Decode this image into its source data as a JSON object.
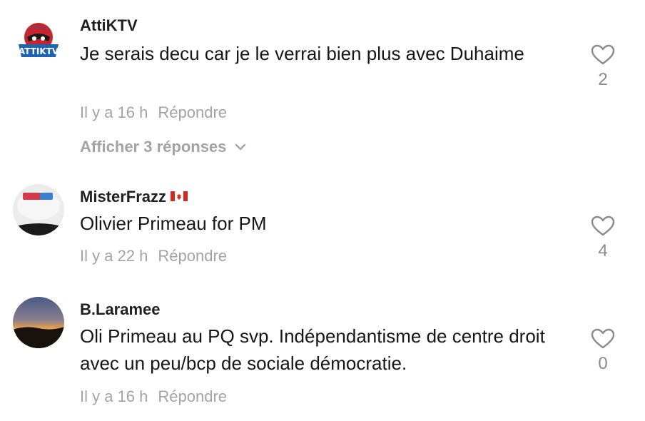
{
  "comments": [
    {
      "username": "AttiKTV",
      "avatar_text": "ATTIKTV",
      "text": "Je serais decu car je le verrai bien plus avec Duhaime",
      "time": "Il y a 16 h",
      "reply_label": "Répondre",
      "view_replies": "Afficher 3 réponses",
      "likes": "2"
    },
    {
      "username": "MisterFrazz",
      "flag_icon": "canada-flag-icon",
      "text": "Olivier Primeau for PM",
      "time": "Il y a 22 h",
      "reply_label": "Répondre",
      "likes": "4"
    },
    {
      "username": "B.Laramee",
      "text": "Oli Primeau au PQ svp. Indépendantisme de centre droit avec un peu/bcp de sociale démocratie.",
      "time": "Il y a 16 h",
      "reply_label": "Répondre",
      "likes": "0"
    }
  ],
  "colors": {
    "primary_text": "#161616",
    "secondary_text": "#a3a3a7",
    "heart_outline": "#8a8a8e"
  }
}
